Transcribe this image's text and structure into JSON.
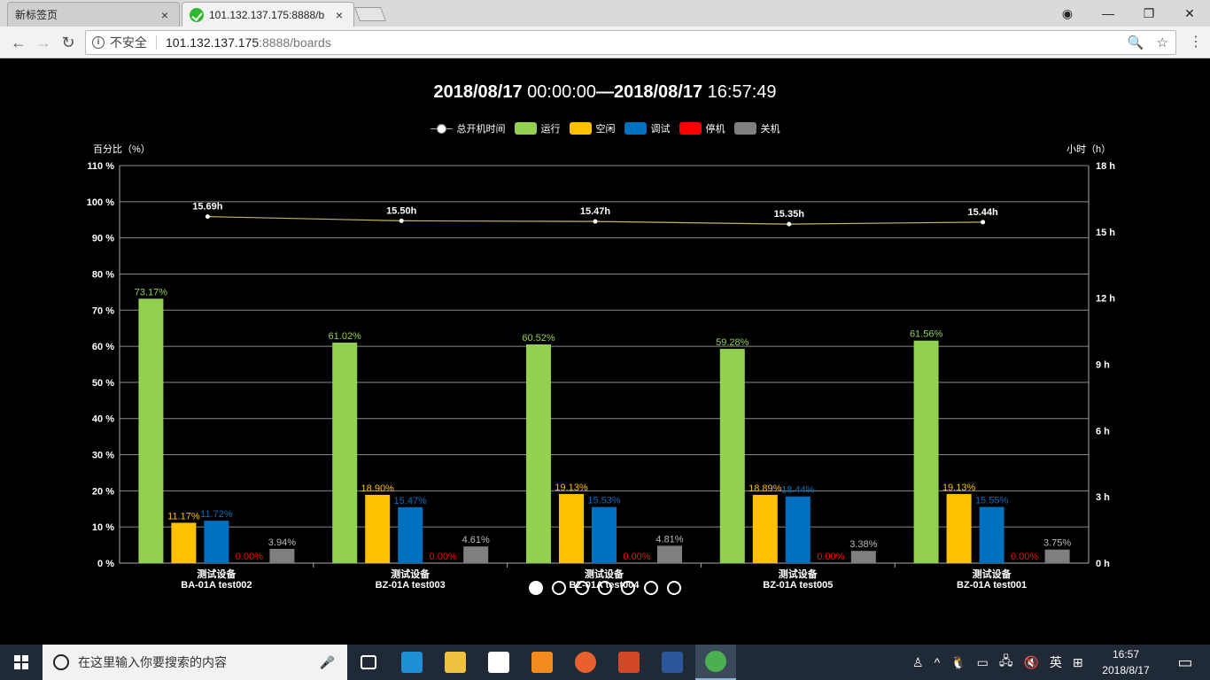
{
  "browser": {
    "tabs": [
      {
        "title": "新标签页",
        "close": "×"
      },
      {
        "title": "101.132.137.175:8888/b",
        "close": "×"
      }
    ],
    "window_controls": {
      "user": "◉",
      "minimize": "—",
      "restore": "❐",
      "close": "✕"
    },
    "nav": {
      "back": "←",
      "forward": "→",
      "reload": "↻"
    },
    "address": {
      "security": "不安全",
      "host": "101.132.137.175",
      "path": ":8888/boards"
    },
    "zoom_icon": "🔍",
    "star_icon": "☆",
    "menu": "⋮"
  },
  "page": {
    "date_start": "2018/08/17",
    "time_start": "00:00:00",
    "separator": "—",
    "date_end": "2018/08/17",
    "time_end": "16:57:49",
    "legend": [
      {
        "label": "总开机时间",
        "color": "#ffffff",
        "kind": "line"
      },
      {
        "label": "运行",
        "color": "#92d050",
        "kind": "bar"
      },
      {
        "label": "空闲",
        "color": "#ffc000",
        "kind": "bar"
      },
      {
        "label": "调试",
        "color": "#0070c0",
        "kind": "bar"
      },
      {
        "label": "停机",
        "color": "#ff0000",
        "kind": "bar"
      },
      {
        "label": "关机",
        "color": "#7f7f7f",
        "kind": "bar"
      }
    ],
    "pager": {
      "count": 7,
      "active": 0
    }
  },
  "chart_data": {
    "type": "bar",
    "left_axis_title": "百分比（%）",
    "right_axis_title": "小时（h）",
    "ylim": [
      0,
      110
    ],
    "y_ticks": [
      0,
      10,
      20,
      30,
      40,
      50,
      60,
      70,
      80,
      90,
      100,
      110
    ],
    "y_unit": " %",
    "y2lim": [
      0,
      18
    ],
    "y2_ticks": [
      0,
      3,
      6,
      9,
      12,
      15,
      18
    ],
    "y2_unit": " h",
    "categories": [
      {
        "line1": "测试设备",
        "line2": "BA-01A test002"
      },
      {
        "line1": "测试设备",
        "line2": "BZ-01A test003"
      },
      {
        "line1": "测试设备",
        "line2": "BZ-01A test004"
      },
      {
        "line1": "测试设备",
        "line2": "BZ-01A test005"
      },
      {
        "line1": "测试设备",
        "line2": "BZ-01A test001"
      }
    ],
    "series": [
      {
        "name": "运行",
        "color": "#92d050",
        "values": [
          73.17,
          61.02,
          60.52,
          59.28,
          61.56
        ],
        "labels": [
          "73.17%",
          "61.02%",
          "60.52%",
          "59.28%",
          "61.56%"
        ]
      },
      {
        "name": "空闲",
        "color": "#ffc000",
        "values": [
          11.17,
          18.9,
          19.13,
          18.89,
          19.13
        ],
        "labels": [
          "11.17%",
          "18.90%",
          "19.13%",
          "18.89%",
          "19.13%"
        ]
      },
      {
        "name": "调试",
        "color": "#0070c0",
        "values": [
          11.72,
          15.47,
          15.53,
          18.44,
          15.55
        ],
        "labels": [
          "11.72%",
          "15.47%",
          "15.53%",
          "18.44%",
          "15.55%"
        ]
      },
      {
        "name": "停机",
        "color": "#ff0000",
        "values": [
          0,
          0,
          0,
          0,
          0
        ],
        "labels": [
          "0.00%",
          "0.00%",
          "0.00%",
          "0.00%",
          "0.00%"
        ]
      },
      {
        "name": "关机",
        "color": "#7f7f7f",
        "values": [
          3.94,
          4.61,
          4.81,
          3.38,
          3.75
        ],
        "labels": [
          "3.94%",
          "4.61%",
          "4.81%",
          "3.38%",
          "3.75%"
        ]
      }
    ],
    "line_series": {
      "name": "总开机时间",
      "color": "#c8b560",
      "axis": "right",
      "values": [
        15.69,
        15.5,
        15.47,
        15.35,
        15.44
      ],
      "labels": [
        "15.69h",
        "15.50h",
        "15.47h",
        "15.35h",
        "15.44h"
      ]
    },
    "grid": true
  },
  "taskbar": {
    "search_placeholder": "在这里输入你要搜索的内容",
    "mic": "🎤",
    "apps": [
      {
        "name": "task-view",
        "color": "#ffffff"
      },
      {
        "name": "edge",
        "color": "#1f8fd6"
      },
      {
        "name": "file-explorer",
        "color": "#f0c040"
      },
      {
        "name": "store",
        "color": "#ffffff"
      },
      {
        "name": "outlook",
        "color": "#f28c1e"
      },
      {
        "name": "firefox",
        "color": "#e8602c"
      },
      {
        "name": "powerpoint",
        "color": "#d24726"
      },
      {
        "name": "word",
        "color": "#2b579a"
      },
      {
        "name": "chrome",
        "color": "#4caf50"
      }
    ],
    "tray": {
      "people": "♙",
      "chevron": "^",
      "ime": "英",
      "grid": "⊞"
    },
    "time": "16:57",
    "date": "2018/8/17",
    "notifications": "▭"
  }
}
